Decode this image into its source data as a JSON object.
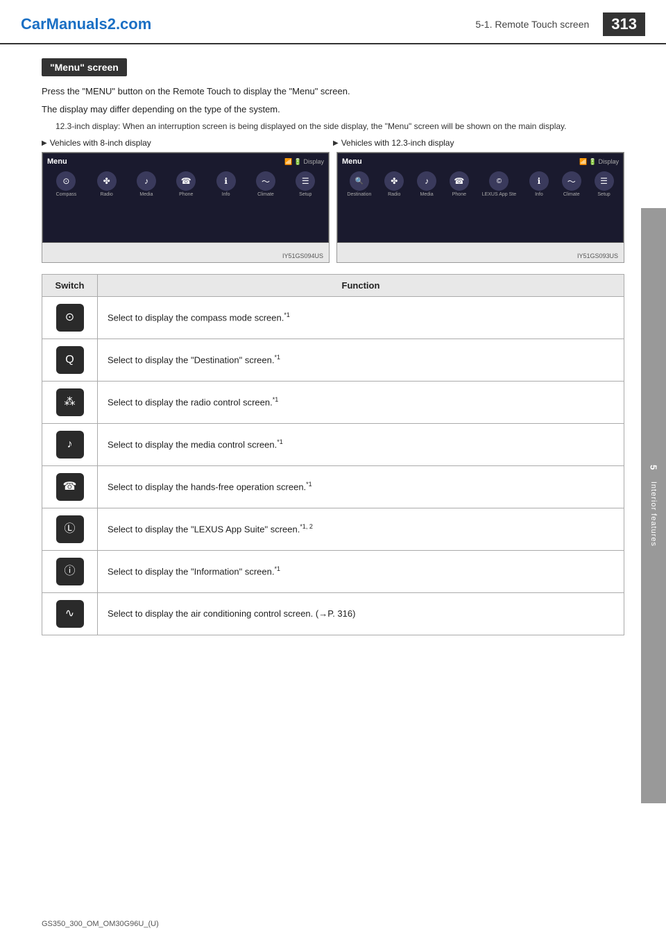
{
  "header": {
    "logo": "CarManuals2.com",
    "chapter": "5-1. Remote Touch screen",
    "page_number": "313"
  },
  "section": {
    "heading": "\"Menu\" screen",
    "intro1": "Press the \"MENU\" button on the Remote Touch to display the \"Menu\" screen.",
    "intro2": "The display may differ depending on the type of the system.",
    "note": "12.3-inch display: When an interruption screen is being displayed on the side display, the \"Menu\" screen will be shown on the main display.",
    "vehicle_label_8": "Vehicles with 8-inch display",
    "vehicle_label_12": "Vehicles with 12.3-inch display",
    "screenshot1_id": "IY51GS094US",
    "screenshot2_id": "IY51GS093US"
  },
  "table": {
    "col_switch": "Switch",
    "col_function": "Function",
    "rows": [
      {
        "icon_symbol": "⊙",
        "icon_label": "compass-icon",
        "function": "Select to display the compass mode screen.",
        "superscript": "*1"
      },
      {
        "icon_symbol": "🔍",
        "icon_label": "destination-icon",
        "function": "Select to display the \"Destination\" screen.",
        "superscript": "*1"
      },
      {
        "icon_symbol": "📻",
        "icon_label": "radio-icon",
        "function": "Select to display the radio control screen.",
        "superscript": "*1"
      },
      {
        "icon_symbol": "♪",
        "icon_label": "media-icon",
        "function": "Select to display the media control screen.",
        "superscript": "*1"
      },
      {
        "icon_symbol": "📞",
        "icon_label": "phone-icon",
        "function": "Select to display the hands-free operation screen.",
        "superscript": "*1"
      },
      {
        "icon_symbol": "©",
        "icon_label": "lexus-app-icon",
        "function": "Select to display the \"LEXUS App Suite\" screen.",
        "superscript": "*1, 2"
      },
      {
        "icon_symbol": "ℹ",
        "icon_label": "info-icon",
        "function": "Select to display the \"Information\" screen.",
        "superscript": "*1"
      },
      {
        "icon_symbol": "~",
        "icon_label": "climate-icon",
        "function": "Select to display the air conditioning control screen. (→P. 316)",
        "superscript": ""
      }
    ]
  },
  "sidebar": {
    "label": "Interior features",
    "number": "5"
  },
  "footer": {
    "document_id": "GS350_300_OM_OM30G96U_(U)"
  },
  "menu_screen_8": {
    "title": "Menu",
    "icons": [
      {
        "symbol": "⊙",
        "label": "Compass"
      },
      {
        "symbol": "✤",
        "label": "Radio"
      },
      {
        "symbol": "♪",
        "label": "Media"
      },
      {
        "symbol": "☎",
        "label": "Phone"
      },
      {
        "symbol": "ℹ",
        "label": "Info"
      },
      {
        "symbol": "〜",
        "label": "Climate"
      },
      {
        "symbol": "☰",
        "label": "Setup"
      }
    ]
  },
  "menu_screen_12": {
    "title": "Menu",
    "icons": [
      {
        "symbol": "🔍",
        "label": "Destination"
      },
      {
        "symbol": "✤",
        "label": "Radio"
      },
      {
        "symbol": "♪",
        "label": "Media"
      },
      {
        "symbol": "☎",
        "label": "Phone"
      },
      {
        "symbol": "©",
        "label": "LEXUS App Suite"
      },
      {
        "symbol": "ℹ",
        "label": "Info"
      },
      {
        "symbol": "〜",
        "label": "Climate"
      },
      {
        "symbol": "☰",
        "label": "Setup"
      }
    ]
  }
}
